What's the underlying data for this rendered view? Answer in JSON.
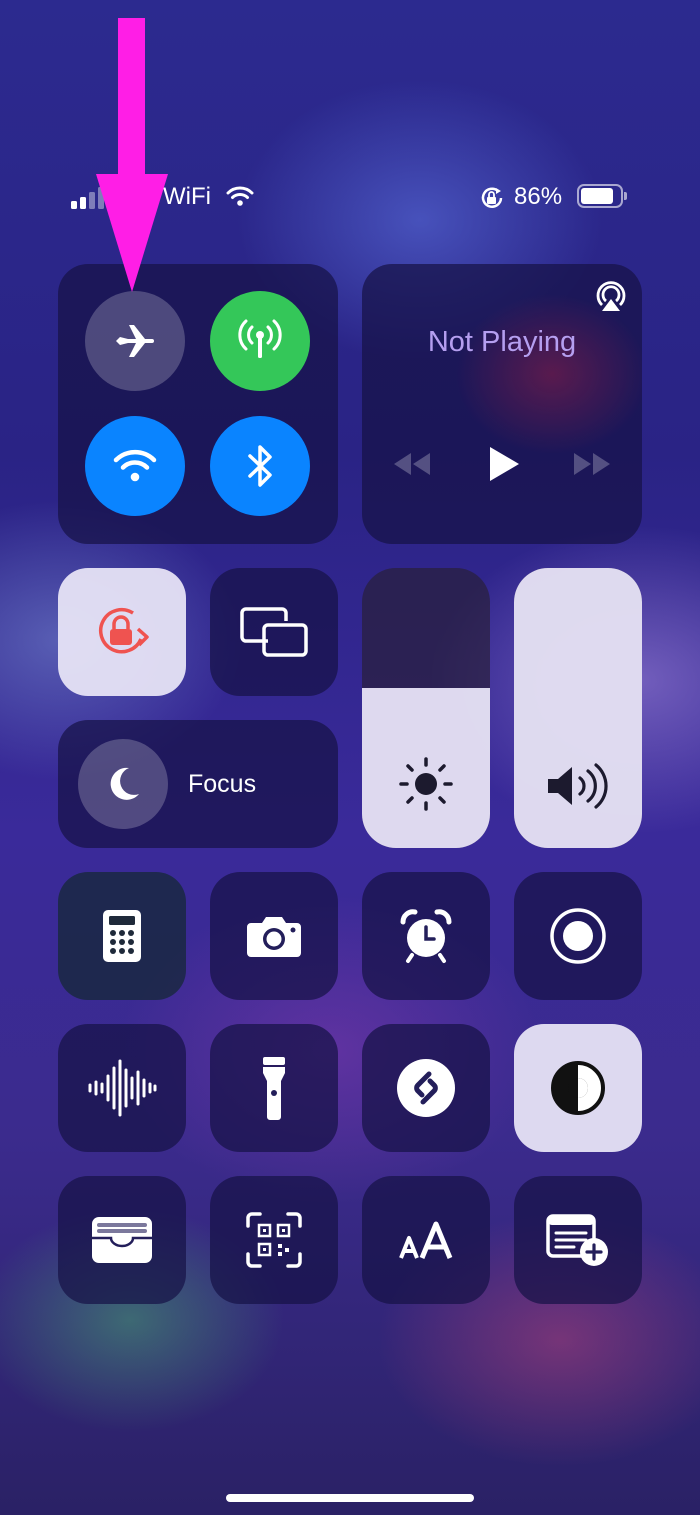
{
  "status_bar": {
    "carrier": "WiFi",
    "battery_percent": "86%",
    "battery_level": 0.86,
    "signal_bars_filled": 2,
    "icons": [
      "signal-bars-icon",
      "wifi-icon",
      "rotation-lock-icon",
      "battery-icon"
    ]
  },
  "connectivity": {
    "airplane": {
      "icon": "airplane-icon",
      "state": "off"
    },
    "cellular": {
      "icon": "antenna-icon",
      "state": "on",
      "color": "#34c759"
    },
    "wifi": {
      "icon": "wifi-icon",
      "state": "on",
      "color": "#0a84ff"
    },
    "bluetooth": {
      "icon": "bluetooth-icon",
      "state": "on",
      "color": "#0a84ff"
    }
  },
  "now_playing": {
    "title": "Not Playing",
    "title_color": "#b59ff0",
    "icons": [
      "airplay-icon",
      "rewind-icon",
      "play-icon",
      "fast-forward-icon"
    ]
  },
  "orientation_lock": {
    "icon": "orientation-lock-icon",
    "state": "on",
    "color": "#ef5350"
  },
  "screen_mirroring": {
    "icon": "screen-mirroring-icon"
  },
  "focus": {
    "label": "Focus",
    "icon": "moon-icon"
  },
  "brightness": {
    "icon": "sun-icon",
    "level": 0.57
  },
  "volume": {
    "icon": "speaker-icon",
    "level": 1.0
  },
  "controls": [
    {
      "name": "calculator",
      "icon": "calculator-icon"
    },
    {
      "name": "camera",
      "icon": "camera-icon"
    },
    {
      "name": "alarm",
      "icon": "alarm-clock-icon"
    },
    {
      "name": "screen-recording",
      "icon": "record-icon"
    },
    {
      "name": "voice-memos",
      "icon": "waveform-icon"
    },
    {
      "name": "flashlight",
      "icon": "flashlight-icon"
    },
    {
      "name": "shazam",
      "icon": "shazam-icon"
    },
    {
      "name": "dark-mode",
      "icon": "dark-mode-icon",
      "state": "on"
    },
    {
      "name": "wallet",
      "icon": "wallet-icon"
    },
    {
      "name": "code-scanner",
      "icon": "qr-code-icon"
    },
    {
      "name": "text-size",
      "icon": "text-size-icon"
    },
    {
      "name": "quick-note",
      "icon": "quick-note-icon"
    }
  ],
  "annotation": {
    "arrow_color": "#ff1ee6",
    "points_to": "airplane-mode"
  }
}
